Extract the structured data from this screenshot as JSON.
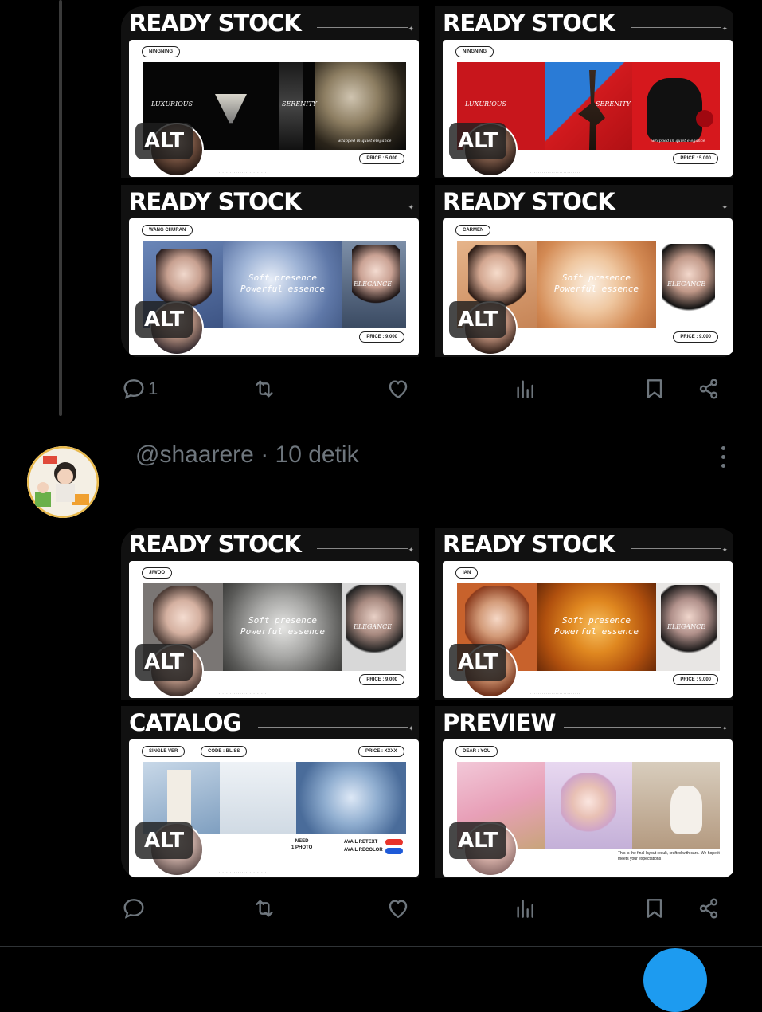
{
  "post1": {
    "images": [
      {
        "title": "READY STOCK",
        "name_pill": "NINGNING",
        "left_text": "LUXURIOUS",
        "mid_text": "SERENITY",
        "small_caption": "wrapped in quiet elegance",
        "price": "PRICE : 5.000",
        "alt": "ALT",
        "theme": "dark"
      },
      {
        "title": "READY STOCK",
        "name_pill": "NINGNING",
        "left_text": "LUXURIOUS",
        "mid_text": "SERENITY",
        "small_caption": "wrapped in quiet elegance",
        "price": "PRICE : 5.000",
        "alt": "ALT",
        "theme": "red"
      },
      {
        "title": "READY STOCK",
        "name_pill": "WANG CHURAN",
        "center_text": "Soft presence\nPowerful essence",
        "right_text": "ELEGANCE",
        "price": "PRICE : 9.000",
        "alt": "ALT",
        "theme": "blue"
      },
      {
        "title": "READY STOCK",
        "name_pill": "CARMEN",
        "center_text": "Soft presence\nPowerful essence",
        "right_text": "ELEGANCE",
        "price": "PRICE : 9.000",
        "alt": "ALT",
        "theme": "peach"
      }
    ],
    "actions": {
      "reply_count": "1"
    }
  },
  "post2": {
    "handle": "@shaarere · 10 detik",
    "images": [
      {
        "title": "READY STOCK",
        "name_pill": "JIWOO",
        "center_text": "Soft presence\nPowerful essence",
        "right_text": "ELEGANCE",
        "price": "PRICE : 9.000",
        "alt": "ALT",
        "theme": "grey"
      },
      {
        "title": "READY STOCK",
        "name_pill": "IAN",
        "center_text": "Soft presence\nPowerful essence",
        "right_text": "ELEGANCE",
        "price": "PRICE : 9.000",
        "alt": "ALT",
        "theme": "orange"
      },
      {
        "title": "CATALOG",
        "pill_a": "SINGLE VER",
        "pill_b": "CODE : BLISS",
        "pill_c": "PRICE : XXXX",
        "need_text": "NEED\n1 PHOTO",
        "avail_a": "AVAIL RETEXT",
        "avail_b": "AVAIL RECOLOR",
        "alt": "ALT",
        "theme": "icy"
      },
      {
        "title": "PREVIEW",
        "name_pill": "DEAR : YOU",
        "caption": "This is the final layout result, crafted with care. We hope it meets your expectations",
        "alt": "ALT",
        "theme": "pastel"
      }
    ]
  },
  "colors": {
    "background": "#000000",
    "muted": "#6e767d",
    "accent": "#1d9bf0"
  },
  "icons": [
    "reply-icon",
    "retweet-icon",
    "like-icon",
    "views-icon",
    "bookmark-icon",
    "share-icon",
    "more-icon"
  ]
}
